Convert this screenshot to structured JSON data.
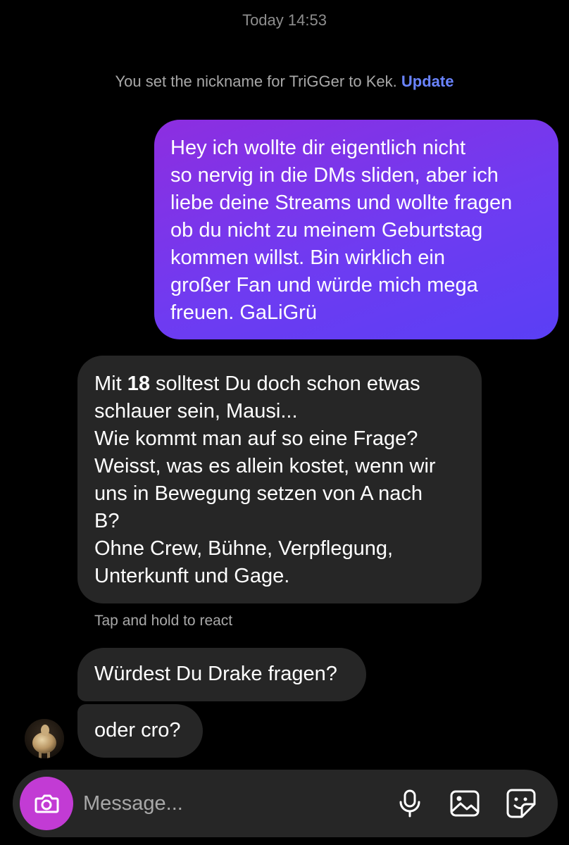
{
  "thread": {
    "timestamp": "Today 14:53",
    "system_note": {
      "text": "You set the nickname for TriGGer to Kek.",
      "action_label": "Update"
    }
  },
  "messages": {
    "outgoing_1": {
      "lines": [
        "Hey ich wollte dir eigentlich nicht",
        "so nervig in die DMs sliden, aber ich",
        "liebe deine Streams und wollte fragen",
        "ob du nicht zu meinem Geburtstag",
        "kommen willst. Bin wirklich ein",
        "großer Fan und würde mich mega",
        "freuen. GaLiGrü"
      ]
    },
    "incoming_1": {
      "first_line_prefix": "Mit ",
      "first_line_bold": "18",
      "first_line_suffix": " solltest Du doch schon etwas",
      "lines": [
        "schlauer sein, Mausi...",
        "Wie kommt man auf so eine Frage?",
        "Weisst, was es allein kostet, wenn wir",
        "uns in Bewegung setzen von A nach",
        "B?",
        "Ohne Crew, Bühne, Verpflegung,",
        "Unterkunft und Gage."
      ]
    },
    "react_hint": "Tap and hold to react",
    "incoming_2": {
      "text": "Würdest Du Drake fragen?"
    },
    "incoming_3": {
      "text": "oder cro?"
    }
  },
  "composer": {
    "placeholder": "Message...",
    "icons": [
      "camera-icon",
      "microphone-icon",
      "gallery-icon",
      "sticker-icon"
    ],
    "camera_button_color": "#c23bd4"
  },
  "colors": {
    "background": "#000000",
    "incoming_bubble": "#262626",
    "outgoing_gradient_start": "#8d2ee0",
    "outgoing_gradient_end": "#5a3ff5",
    "link": "#6a84ff",
    "muted_text": "#a8a8a8"
  }
}
